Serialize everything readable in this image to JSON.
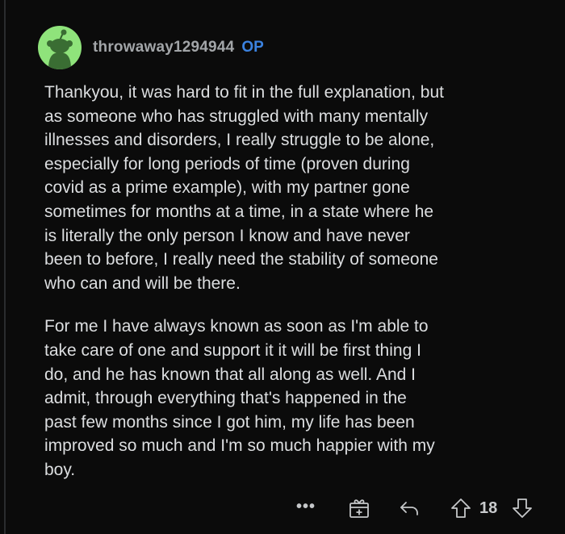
{
  "comment": {
    "username": "throwaway1294944",
    "op_badge": "OP",
    "avatar_icon": "snoo-avatar-icon",
    "avatar_color": "#8fe37b",
    "paragraphs": [
      "Thankyou, it was hard to fit in the full explanation, but\nas someone who has struggled with many mentally\nillnesses and disorders, I really struggle to be alone,\nespecially for long periods of time (proven during\ncovid as a prime example), with my partner gone\nsometimes for months at a time, in a state where he\nis literally the only person I know and have never\nbeen to before, I really need the stability of someone\nwho can and will be there.",
      "For me I have always known as soon as I'm able to\ntake care of one and support it it will be first thing I\ndo, and he has known that all along as well. And I\nadmit, through everything that's happened in the\npast few months since I got him, my life has been\nimproved so much and I'm so much happier with my\nboy."
    ]
  },
  "actions": {
    "more_label": "•••",
    "more_icon": "more-options-icon",
    "award_icon": "award-gift-icon",
    "reply_icon": "reply-arrow-icon",
    "upvote_icon": "upvote-arrow-icon",
    "score": "18",
    "downvote_icon": "downvote-arrow-icon"
  },
  "colors": {
    "background": "#0b0b0b",
    "op_badge": "#3b82e0",
    "username": "#a2a5a8",
    "body_text": "#dcdee0"
  }
}
